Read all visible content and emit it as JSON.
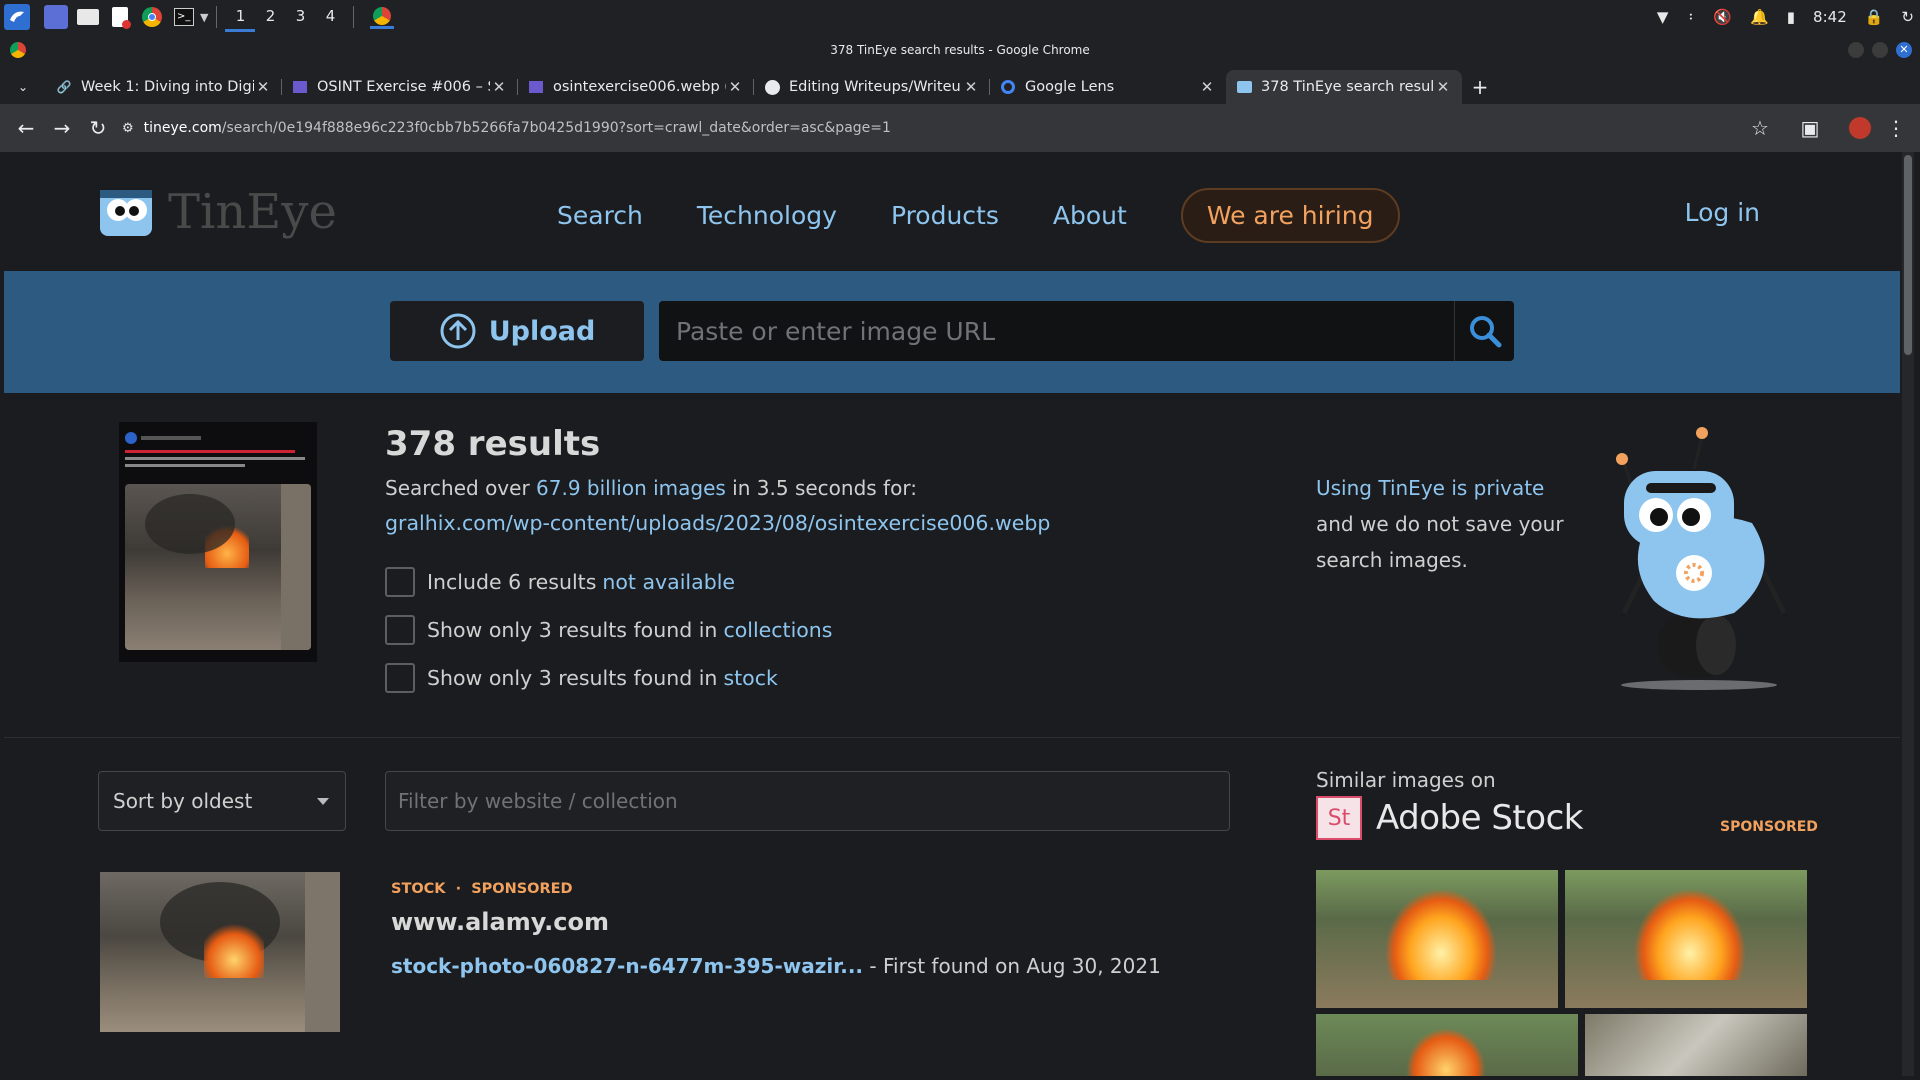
{
  "taskbar": {
    "workspaces": [
      "1",
      "2",
      "3",
      "4"
    ],
    "time": "8:42"
  },
  "window": {
    "title": "378 TinEye search results - Google Chrome"
  },
  "tabs": [
    {
      "label": "Week 1: Diving into Digita",
      "icon": "link-icon"
    },
    {
      "label": "OSINT Exercise #006 – S",
      "icon": "site-icon"
    },
    {
      "label": "osintexercise006.webp (",
      "icon": "site-icon"
    },
    {
      "label": "Editing Writeups/Writeup",
      "icon": "github-icon"
    },
    {
      "label": "Google Lens",
      "icon": "lens-icon"
    },
    {
      "label": "378 TinEye search results",
      "icon": "tineye-icon"
    }
  ],
  "omnibox": {
    "host": "tineye.com",
    "path": "/search/0e194f888e96c223f0cbb7b5266fa7b0425d1990?sort=crawl_date&order=asc&page=1"
  },
  "site": {
    "logo_text": "TinEye",
    "nav": [
      "Search",
      "Technology",
      "Products",
      "About"
    ],
    "hiring": "We are hiring",
    "login": "Log in",
    "upload_label": "Upload",
    "url_placeholder": "Paste or enter image URL"
  },
  "summary": {
    "count": "378 results",
    "searched_prefix": "Searched over ",
    "searched_link": "67.9 billion images",
    "searched_suffix": " in 3.5 seconds for:",
    "query_url": "gralhix.com/wp-content/uploads/2023/08/osintexercise006.webp",
    "options": [
      {
        "prefix": "Include 6 results ",
        "link": "not available"
      },
      {
        "prefix": "Show only 3 results found in ",
        "link": "collections"
      },
      {
        "prefix": "Show only 3 results found in ",
        "link": "stock"
      }
    ],
    "private_link": "Using TinEye is private",
    "private_line2": "and we do not save your",
    "private_line3": "search images."
  },
  "filters": {
    "sort_value": "Sort by oldest",
    "filter_placeholder": "Filter by website / collection"
  },
  "similar": {
    "label": "Similar images on",
    "brand": "Adobe Stock",
    "brand_mark": "St",
    "sponsored": "SPONSORED"
  },
  "result": {
    "tag1": "STOCK",
    "dot": "·",
    "tag2": "SPONSORED",
    "site": "www.alamy.com",
    "link": "stock-photo-060827-n-6477m-395-wazir...",
    "found": " - First found on Aug 30, 2021"
  },
  "colors": {
    "link": "#8ec5ef",
    "accent_orange": "#f2a25e",
    "search_band": "#2d5a80"
  }
}
